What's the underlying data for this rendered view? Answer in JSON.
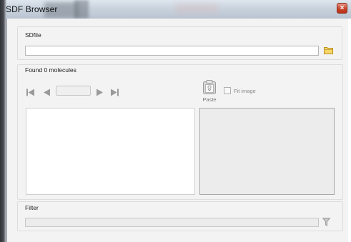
{
  "window": {
    "title": "SDF Browser",
    "close_glyph": "×"
  },
  "sdfile": {
    "group_label": "SDfile",
    "path_value": "",
    "browse_icon": "folder-icon"
  },
  "molecules": {
    "group_label": "Found 0 molecules",
    "current_index": "",
    "nav_icons": [
      "first-icon",
      "previous-icon",
      "next-icon",
      "last-icon"
    ],
    "paste_label": "Paste",
    "fit_image_label": "Fit image",
    "fit_image_checked": false
  },
  "filter": {
    "group_label": "Filter",
    "value": "",
    "icon": "funnel-icon"
  },
  "colors": {
    "close_button": "#c8432b",
    "disabled_icon": "#9a9a9a",
    "folder": "#e9c350"
  }
}
